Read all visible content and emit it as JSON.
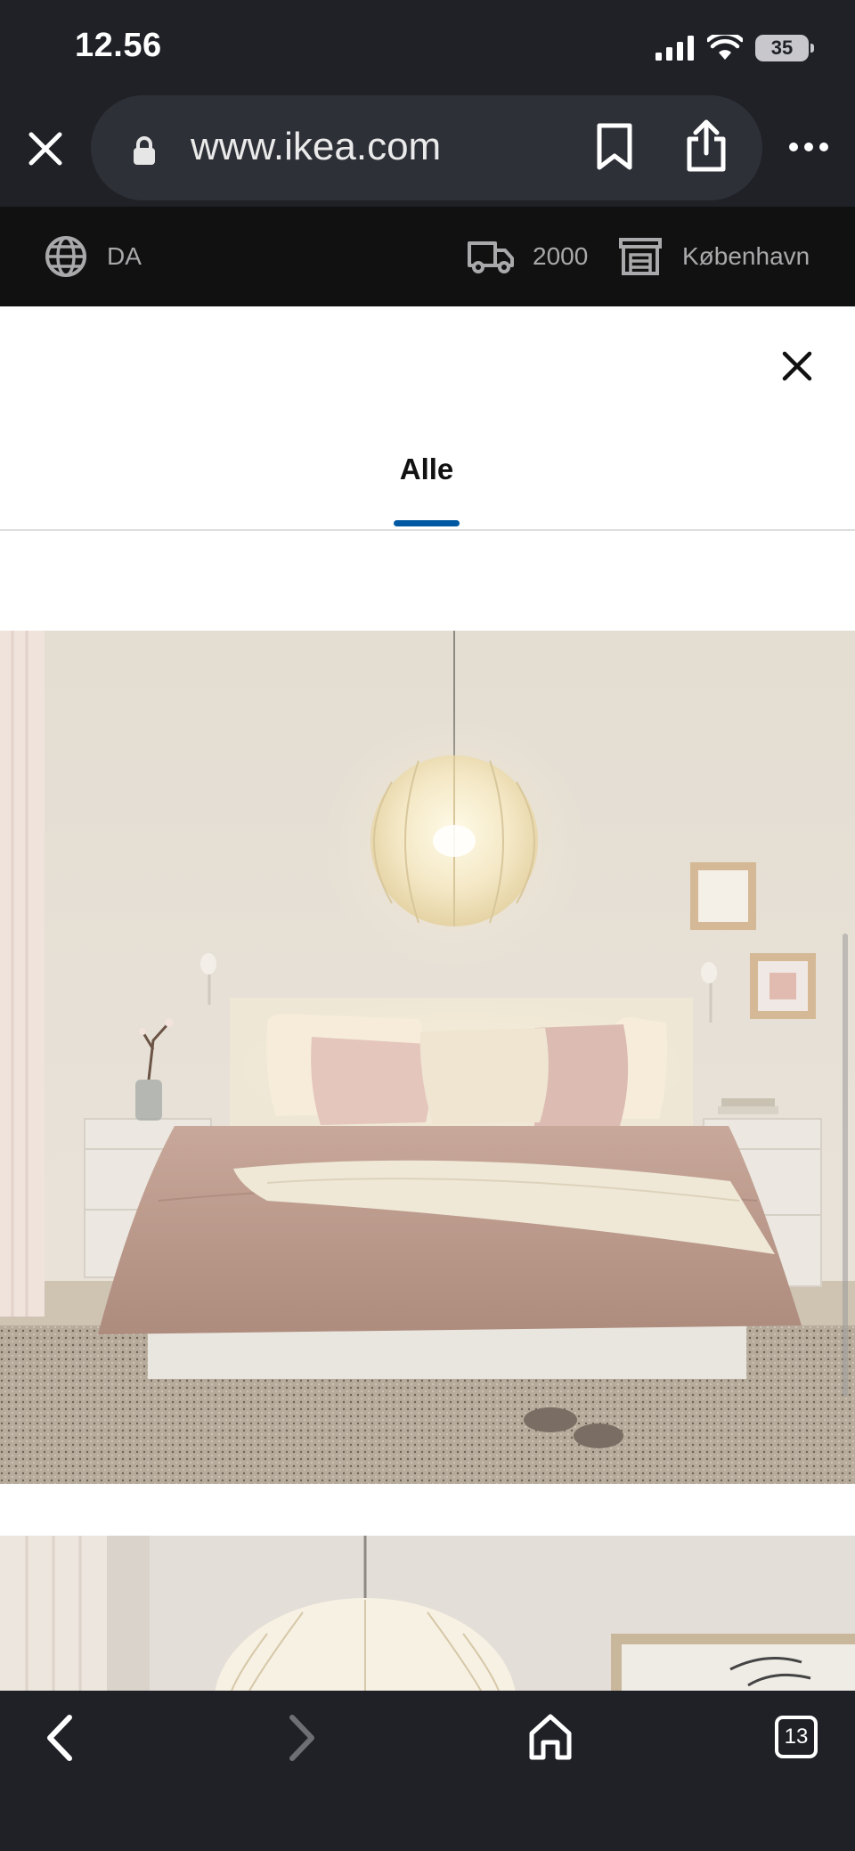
{
  "status_bar": {
    "time": "12.56",
    "battery": "35",
    "icons": [
      "cellular-signal-icon",
      "wifi-icon",
      "battery-icon"
    ]
  },
  "browser": {
    "url": "www.ikea.com",
    "icons": [
      "close-icon",
      "lock-icon",
      "bookmark-icon",
      "share-icon",
      "more-icon"
    ]
  },
  "ikea_strip": {
    "language": "DA",
    "zip_code": "2000",
    "store": "København",
    "icons": [
      "globe-icon",
      "delivery-truck-icon",
      "store-icon"
    ]
  },
  "modal": {
    "tabs": [
      {
        "label": "Alle",
        "selected": true
      }
    ],
    "images": [
      {
        "alt": "bedroom-pendant-lamp-scene",
        "visible_portion": 1.0
      },
      {
        "alt": "pendant-lamp-closeup-scene",
        "visible_portion": 0.3
      }
    ]
  },
  "bottom_toolbar": {
    "tab_count": "13",
    "icons": [
      "back-arrow-icon",
      "forward-arrow-icon",
      "home-icon",
      "tabs-icon"
    ]
  },
  "colors": {
    "browser_chrome": "#202127",
    "ikea_strip": "#111111",
    "tab_underline": "#0058a3"
  }
}
